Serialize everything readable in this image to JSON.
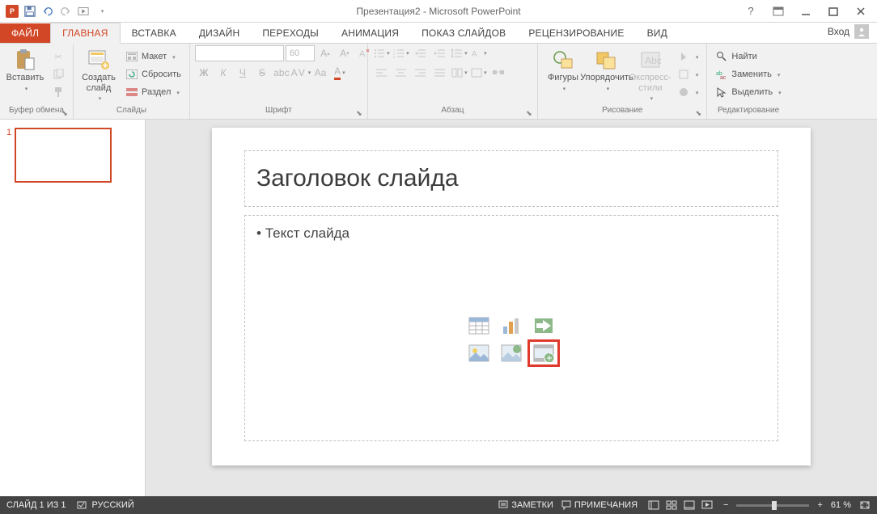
{
  "titlebar": {
    "app_icon_text": "P",
    "title": "Презентация2 - Microsoft PowerPoint"
  },
  "signin": {
    "label": "Вход"
  },
  "tabs": {
    "file": "ФАЙЛ",
    "items": [
      "ГЛАВНАЯ",
      "ВСТАВКА",
      "ДИЗАЙН",
      "ПЕРЕХОДЫ",
      "АНИМАЦИЯ",
      "ПОКАЗ СЛАЙДОВ",
      "РЕЦЕНЗИРОВАНИЕ",
      "ВИД"
    ],
    "active_index": 0
  },
  "ribbon": {
    "clipboard": {
      "paste": "Вставить",
      "group": "Буфер обмена"
    },
    "slides": {
      "new_slide": "Создать\nслайд",
      "layout": "Макет",
      "reset": "Сбросить",
      "section": "Раздел",
      "group": "Слайды"
    },
    "font": {
      "size_value": "60",
      "bold": "Ж",
      "italic": "К",
      "underline": "Ч",
      "strike": "S",
      "group": "Шрифт"
    },
    "paragraph": {
      "group": "Абзац"
    },
    "drawing": {
      "shapes": "Фигуры",
      "arrange": "Упорядочить",
      "styles": "Экспресс-\nстили",
      "group": "Рисование"
    },
    "editing": {
      "find": "Найти",
      "replace": "Заменить",
      "select": "Выделить",
      "group": "Редактирование"
    }
  },
  "thumbnails": {
    "num": "1"
  },
  "slide": {
    "title_placeholder": "Заголовок слайда",
    "body_placeholder": "Текст слайда"
  },
  "statusbar": {
    "slide_count": "СЛАЙД 1 ИЗ 1",
    "language": "РУССКИЙ",
    "notes": "ЗАМЕТКИ",
    "comments": "ПРИМЕЧАНИЯ",
    "zoom": "61 %"
  }
}
